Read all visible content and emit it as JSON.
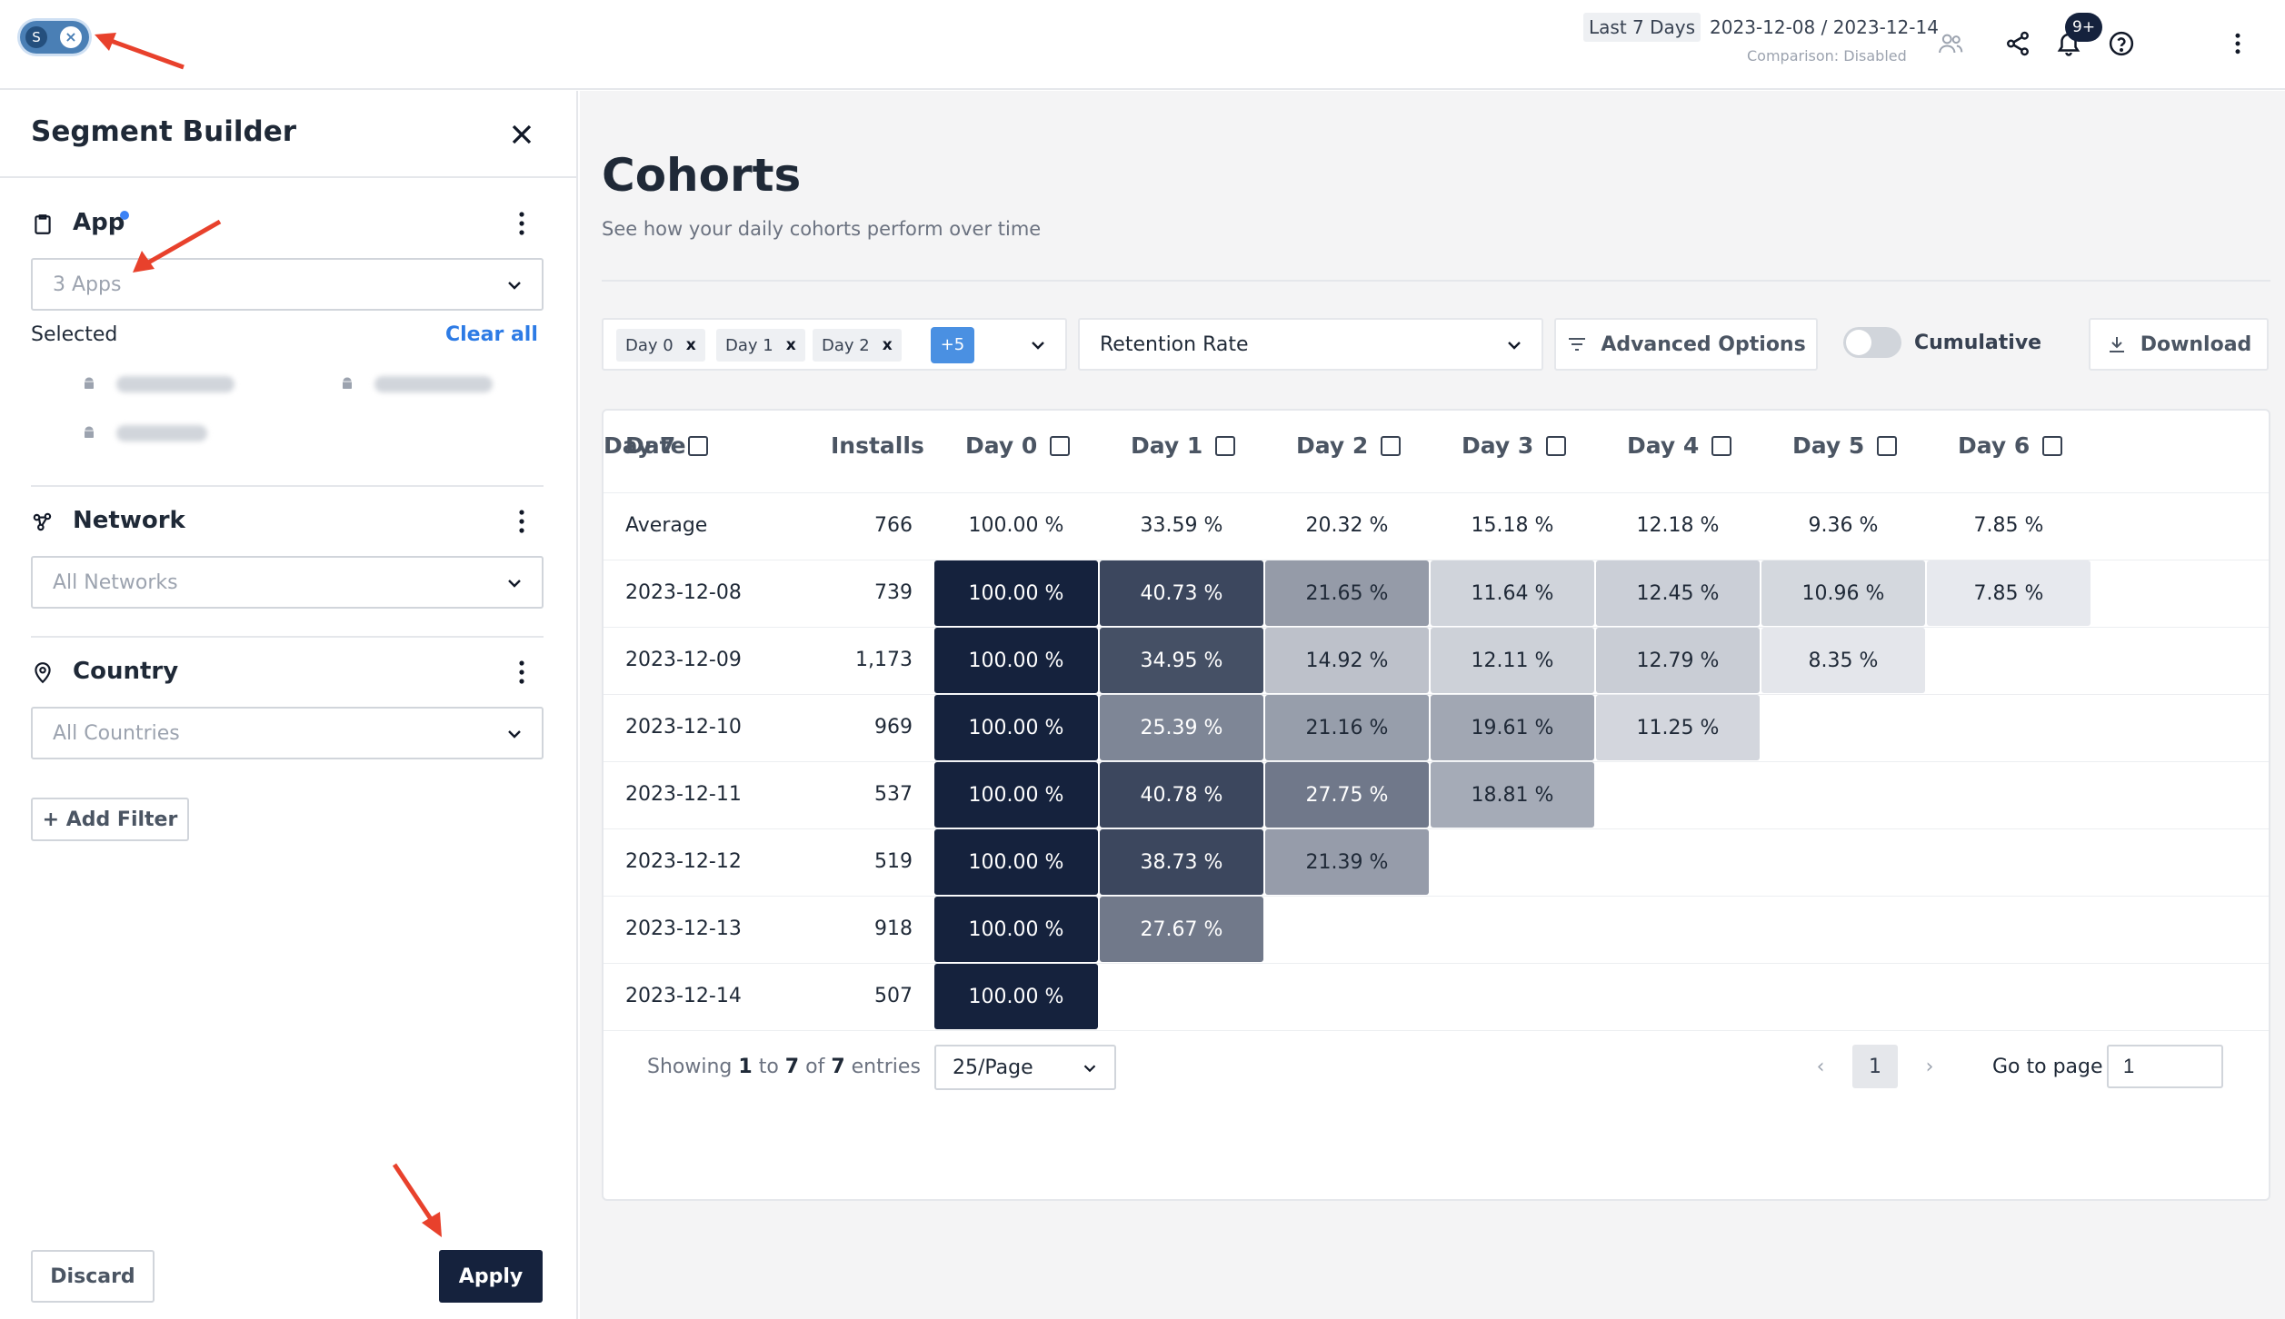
{
  "topbar": {
    "segment_toggle_letter": "S",
    "segment_toggle_close": "×",
    "date_preset": "Last 7 Days",
    "date_range": "2023-12-08 / 2023-12-14",
    "comparison": "Comparison: Disabled",
    "notification_badge": "9+"
  },
  "sidebar": {
    "title": "Segment Builder",
    "app": {
      "title": "App",
      "select_placeholder": "3 Apps",
      "selected_label": "Selected",
      "clear_all": "Clear all",
      "selected_apps_count": 3
    },
    "network": {
      "title": "Network",
      "select_placeholder": "All Networks"
    },
    "country": {
      "title": "Country",
      "select_placeholder": "All Countries"
    },
    "add_filter": "+ Add Filter",
    "discard": "Discard",
    "apply": "Apply"
  },
  "main": {
    "title": "Cohorts",
    "subtitle": "See how your daily cohorts perform over time",
    "day_chips": [
      {
        "label": "Day 0",
        "x": "x"
      },
      {
        "label": "Day 1",
        "x": "x"
      },
      {
        "label": "Day 2",
        "x": "x"
      }
    ],
    "day_chips_more": "+5",
    "metric_select": "Retention Rate",
    "advanced_options": "Advanced Options",
    "cumulative_label": "Cumulative",
    "cumulative_on": false,
    "download": "Download"
  },
  "table": {
    "headers": [
      "Date",
      "Installs",
      "Day 0",
      "Day 1",
      "Day 2",
      "Day 3",
      "Day 4",
      "Day 5",
      "Day 6",
      "Day 7"
    ],
    "average": {
      "label": "Average",
      "installs": "766",
      "values": [
        "100.00 %",
        "33.59 %",
        "20.32 %",
        "15.18 %",
        "12.18 %",
        "9.36 %",
        "7.85 %"
      ]
    },
    "rows": [
      {
        "date": "2023-12-08",
        "installs": "739",
        "values": [
          "100.00 %",
          "40.73 %",
          "21.65 %",
          "11.64 %",
          "12.45 %",
          "10.96 %",
          "7.85 %"
        ]
      },
      {
        "date": "2023-12-09",
        "installs": "1,173",
        "values": [
          "100.00 %",
          "34.95 %",
          "14.92 %",
          "12.11 %",
          "12.79 %",
          "8.35 %"
        ]
      },
      {
        "date": "2023-12-10",
        "installs": "969",
        "values": [
          "100.00 %",
          "25.39 %",
          "21.16 %",
          "19.61 %",
          "11.25 %"
        ]
      },
      {
        "date": "2023-12-11",
        "installs": "537",
        "values": [
          "100.00 %",
          "40.78 %",
          "27.75 %",
          "18.81 %"
        ]
      },
      {
        "date": "2023-12-12",
        "installs": "519",
        "values": [
          "100.00 %",
          "38.73 %",
          "21.39 %"
        ]
      },
      {
        "date": "2023-12-13",
        "installs": "918",
        "values": [
          "100.00 %",
          "27.67 %"
        ]
      },
      {
        "date": "2023-12-14",
        "installs": "507",
        "values": [
          "100.00 %"
        ]
      }
    ],
    "colors": {
      "scale_dark": "#15223d",
      "scale_light": "#eceef2"
    }
  },
  "footer": {
    "showing": "Showing",
    "from": "1",
    "to_word": "to",
    "to": "7",
    "of_word": "of",
    "total": "7",
    "entries": "entries",
    "per_page": "25/Page",
    "prev": "‹",
    "current_page": "1",
    "next": "›",
    "goto_label": "Go to page",
    "goto_value": "1"
  },
  "colors": {
    "accent": "#2d7be5",
    "primary_dark": "#15223d",
    "annotation_arrow": "#e8412c"
  }
}
